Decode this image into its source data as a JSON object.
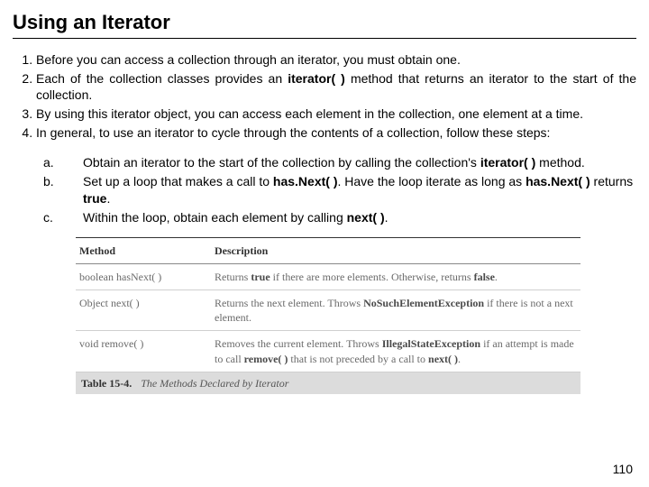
{
  "title": "Using an Iterator",
  "list": {
    "i1": "Before you can access a collection through an iterator, you must obtain one.",
    "i2a": "Each of the collection classes provides an ",
    "i2b": "iterator( )",
    "i2c": " method that returns an iterator to the start of the collection.",
    "i3": "By using this iterator object, you can access each element in the collection, one element at a time.",
    "i4": "In general, to use an iterator to cycle through the contents of a collection, follow these steps:"
  },
  "sub": {
    "a_m": "a.",
    "a1": "Obtain an iterator to the start of the collection by calling the collection's ",
    "a2": "iterator( )",
    "a3": " method.",
    "b_m": "b.",
    "b1": "Set up a loop that makes a call to ",
    "b2": "has.Next( )",
    "b3": ". Have the loop iterate as long as ",
    "b4": "has.Next( )",
    "b5": " returns ",
    "b6": "true",
    "b7": ".",
    "c_m": "c.",
    "c1": "Within the loop, obtain each element by calling ",
    "c2": "next( )",
    "c3": "."
  },
  "table": {
    "h1": "Method",
    "h2": "Description",
    "r1c1": "boolean hasNext( )",
    "r1a": "Returns ",
    "r1b": "true",
    "r1c": " if there are more elements. Otherwise, returns ",
    "r1d": "false",
    "r1e": ".",
    "r2c1": "Object next( )",
    "r2a": "Returns the next element. Throws ",
    "r2b": "NoSuchElementException",
    "r2c": " if there is not a next element.",
    "r3c1": "void remove( )",
    "r3a": "Removes the current element. Throws ",
    "r3b": "IllegalStateException",
    "r3c": " if an attempt is made to call ",
    "r3d": "remove( )",
    "r3e": " that is not preceded by a call to ",
    "r3f": "next( )",
    "r3g": ".",
    "cap_label": "Table 15-4.",
    "cap_text": "The Methods Declared by Iterator"
  },
  "page": "110"
}
